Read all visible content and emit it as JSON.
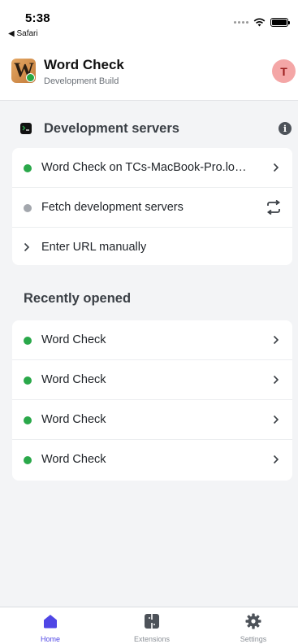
{
  "status_bar": {
    "time": "5:38",
    "back_app": "◀ Safari"
  },
  "header": {
    "app_name": "Word Check",
    "subtitle": "Development Build",
    "avatar_initial": "T"
  },
  "dev_servers": {
    "title": "Development servers",
    "rows": [
      {
        "label": "Word Check on TCs-MacBook-Pro.lo…",
        "status": "green"
      },
      {
        "label": "Fetch development servers",
        "status": "gray"
      },
      {
        "label": "Enter URL manually"
      }
    ]
  },
  "recent": {
    "title": "Recently opened",
    "items": [
      {
        "label": "Word Check",
        "status": "green"
      },
      {
        "label": "Word Check",
        "status": "green"
      },
      {
        "label": "Word Check",
        "status": "green"
      },
      {
        "label": "Word Check",
        "status": "green"
      }
    ]
  },
  "tabs": [
    {
      "label": "Home",
      "icon": "home-icon",
      "active": true
    },
    {
      "label": "Extensions",
      "icon": "extensions-icon",
      "active": false
    },
    {
      "label": "Settings",
      "icon": "gear-icon",
      "active": false
    }
  ],
  "colors": {
    "accent": "#4f46e5",
    "online": "#2aa84a",
    "offline": "#a3a7ad",
    "avatar_bg": "#f4a6a6"
  }
}
